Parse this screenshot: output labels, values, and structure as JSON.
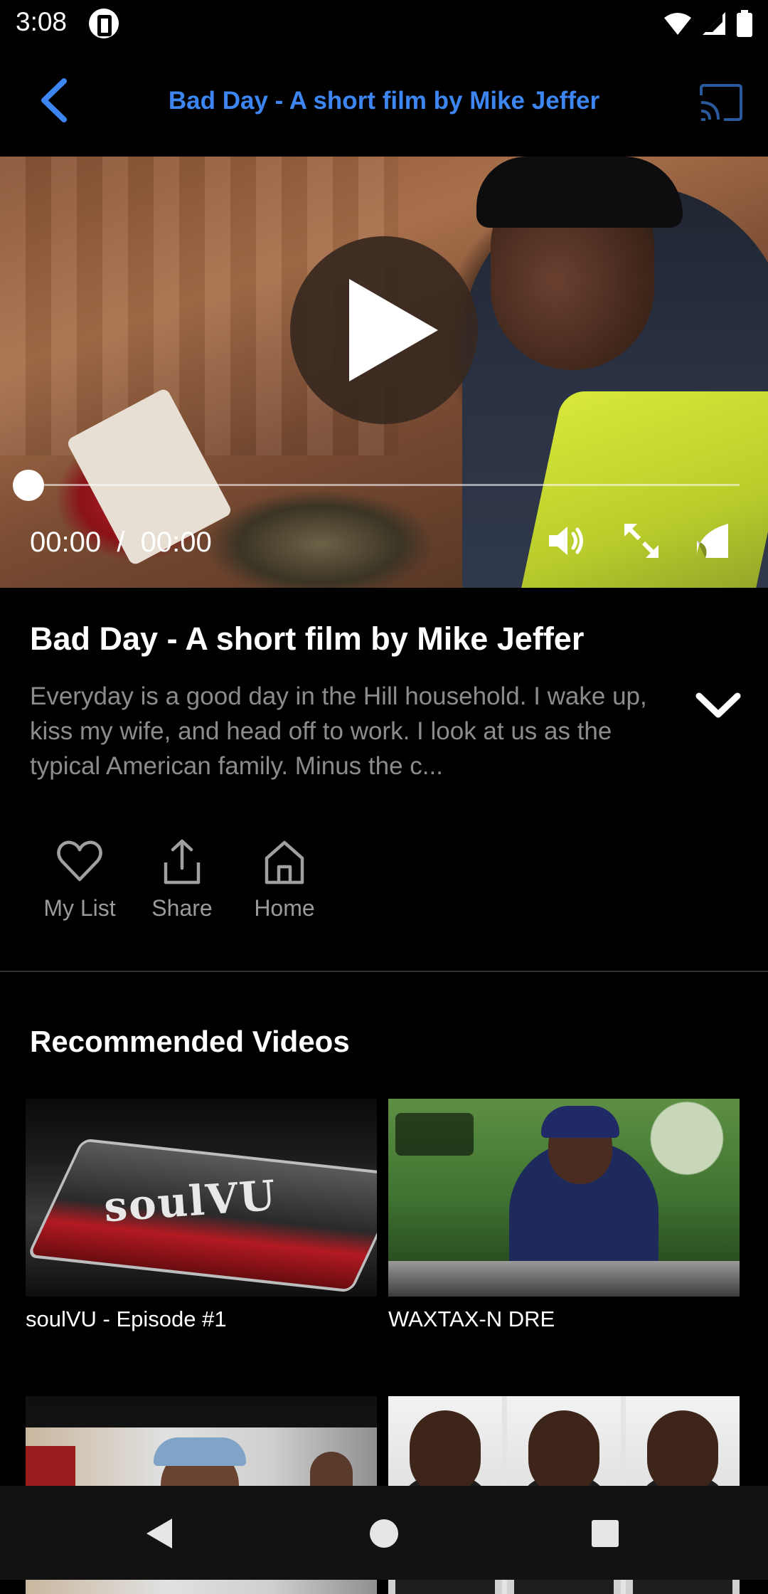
{
  "status_bar": {
    "time": "3:08"
  },
  "app_bar": {
    "title": "Bad Day - A short film by Mike Jeffer"
  },
  "player": {
    "time_display": "00:00  /  00:00",
    "progress": 0
  },
  "video": {
    "title": "Bad Day - A short film by Mike Jeffer",
    "description": "Everyday is a good day in the Hill household.  I wake up, kiss my wife, and head off to work. I look at us as the typical American family. Minus the c..."
  },
  "actions": [
    {
      "label": "My List",
      "icon": "heart-icon"
    },
    {
      "label": "Share",
      "icon": "share-icon"
    },
    {
      "label": "Home",
      "icon": "home-icon"
    }
  ],
  "recommended": {
    "heading": "Recommended Videos",
    "items": [
      {
        "title": "soulVU - Episode #1",
        "thumb_text": "soulVU"
      },
      {
        "title": "WAXTAX-N DRE"
      },
      {
        "title": ""
      },
      {
        "title": ""
      }
    ]
  },
  "colors": {
    "accent": "#3d86f2",
    "background": "#000000",
    "muted_text": "#8c8c8c"
  }
}
